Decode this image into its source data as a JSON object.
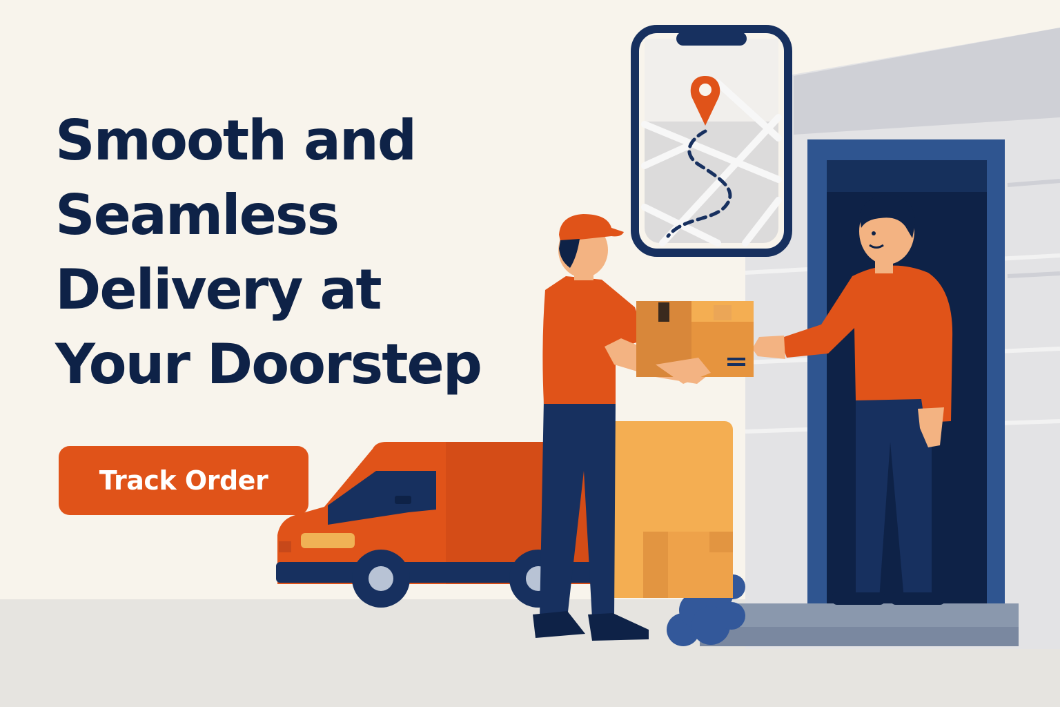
{
  "hero": {
    "headline_lines": [
      "Smooth and",
      "Seamless",
      "Delivery at",
      "Your Doorstep"
    ],
    "cta_label": "Track Order"
  },
  "icons": [
    "map-pin-icon",
    "phone-map-icon"
  ],
  "colors": {
    "background": "#f8f4ec",
    "headline": "#0e2247",
    "accent": "#e05319",
    "navy": "#17305f",
    "door": "#2f5590",
    "box": "#e9a04c"
  }
}
